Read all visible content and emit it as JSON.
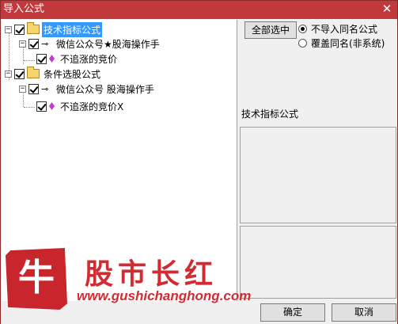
{
  "window": {
    "title": "导入公式",
    "close_glyph": "✕"
  },
  "tree": {
    "nodes": [
      {
        "label": "技术指标公式",
        "checked": true,
        "expander": "−"
      },
      {
        "label": "微信公众号★股海操作手",
        "checked": true,
        "expander": "−",
        "icon": "⊸"
      },
      {
        "label": "不追涨的竞价",
        "checked": true
      },
      {
        "label": "条件选股公式",
        "checked": true,
        "expander": "−"
      },
      {
        "label": "微信公众号 股海操作手",
        "checked": true,
        "expander": "−",
        "icon": "⊸"
      },
      {
        "label": "不追涨的竞价X",
        "checked": true
      }
    ]
  },
  "options": {
    "select_all_label": "全部选中",
    "radio_no_import": "不导入同名公式",
    "radio_overwrite": "覆盖同名(非系统)"
  },
  "info": {
    "category_label": "技术指标公式"
  },
  "footer": {
    "ok_label": "确定",
    "cancel_label": "取消"
  },
  "watermark": {
    "badge_char": "牛",
    "title": "股市长红",
    "url": "www.gushichanghong.com"
  },
  "colors": {
    "title_bar": "#c1393d",
    "selection": "#3399ff",
    "watermark": "#d22b32"
  }
}
